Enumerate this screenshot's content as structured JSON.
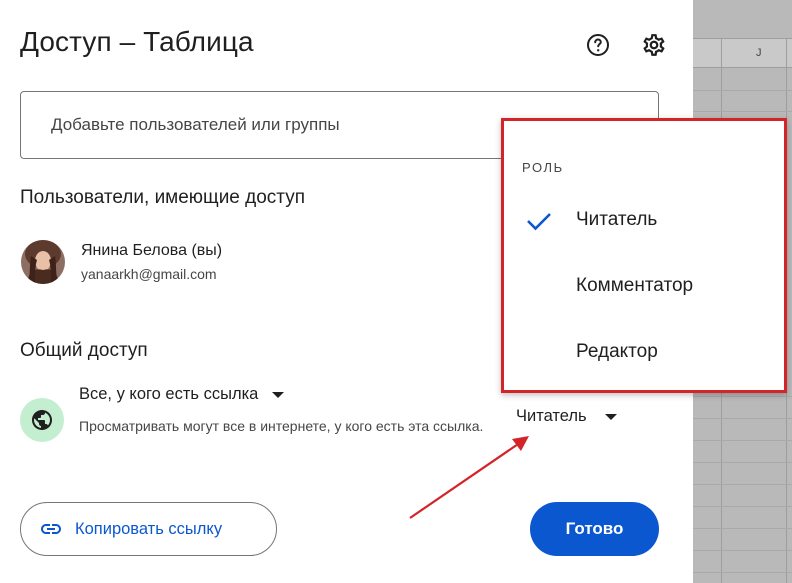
{
  "dialog": {
    "title": "Доступ – Таблица",
    "help_icon": "help-circle-icon",
    "settings_icon": "gear-icon",
    "add_people_placeholder": "Добавьте пользователей или группы"
  },
  "people_section": {
    "title": "Пользователи, имеющие доступ",
    "users": [
      {
        "name": "Янина Белова (вы)",
        "email": "yanaarkh@gmail.com"
      }
    ]
  },
  "general_access": {
    "title": "Общий доступ",
    "link_setting": "Все, у кого есть ссылка",
    "description": "Просматривать могут все в интернете, у кого есть эта ссылка.",
    "role": "Читатель",
    "icon": "globe-icon"
  },
  "buttons": {
    "copy_link": "Копировать ссылку",
    "done": "Готово"
  },
  "role_menu": {
    "header": "РОЛЬ",
    "items": [
      {
        "label": "Читатель",
        "selected": true
      },
      {
        "label": "Комментатор",
        "selected": false
      },
      {
        "label": "Редактор",
        "selected": false
      }
    ]
  },
  "sheet": {
    "column_label": "J"
  },
  "colors": {
    "accent": "#0b57d0",
    "highlight_border": "#d3242a",
    "globe_bg": "#c4eed0"
  }
}
